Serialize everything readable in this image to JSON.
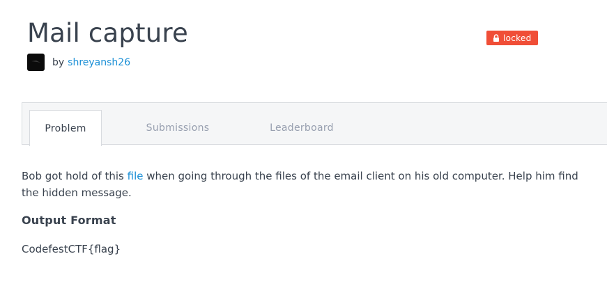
{
  "challenge": {
    "title": "Mail capture",
    "status_badge": "locked"
  },
  "author": {
    "by_label": "by",
    "username": "shreyansh26"
  },
  "tabs": [
    {
      "label": "Problem",
      "active": true
    },
    {
      "label": "Submissions",
      "active": false
    },
    {
      "label": "Leaderboard",
      "active": false
    }
  ],
  "problem": {
    "description_before_link": "Bob got hold of this ",
    "link_text": "file",
    "description_after_link": " when going through the files of the email client on his old computer. Help him find the hidden message.",
    "output_format_heading": "Output Format",
    "output_format_text": "CodefestCTF{flag}"
  },
  "colors": {
    "accent_link": "#1a8fd6",
    "badge_red": "#f04e37",
    "text_dark": "#39424e",
    "tab_inactive": "#979faf"
  },
  "icons": {
    "badge": "lock-icon",
    "avatar": "user-avatar"
  }
}
